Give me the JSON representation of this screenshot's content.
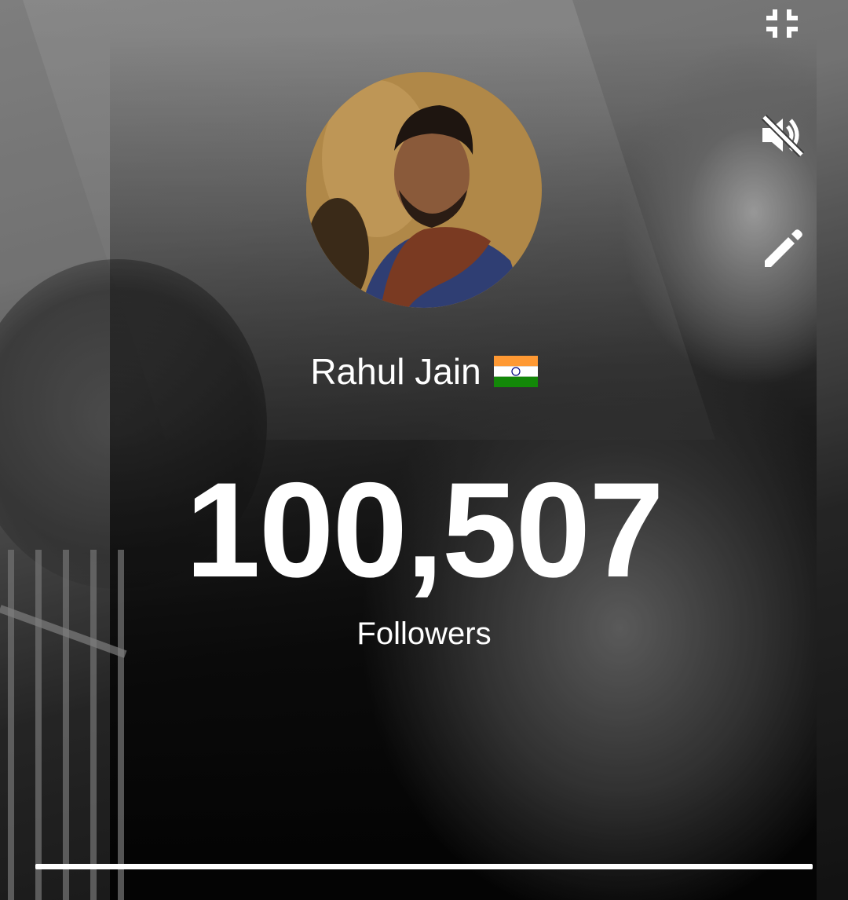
{
  "profile": {
    "name": "Rahul Jain",
    "flag": "india-flag-icon"
  },
  "stats": {
    "count": "100,507",
    "label": "Followers"
  },
  "controls": [
    {
      "icon": "fullscreen-exit-icon"
    },
    {
      "icon": "volume-off-icon"
    },
    {
      "icon": "edit-pencil-icon"
    }
  ],
  "progress": {
    "fraction": 1.0
  },
  "colors": {
    "text": "#ffffff",
    "flag_saffron": "#FF9933",
    "flag_white": "#FFFFFF",
    "flag_green": "#138808",
    "flag_chakra": "#000080"
  }
}
